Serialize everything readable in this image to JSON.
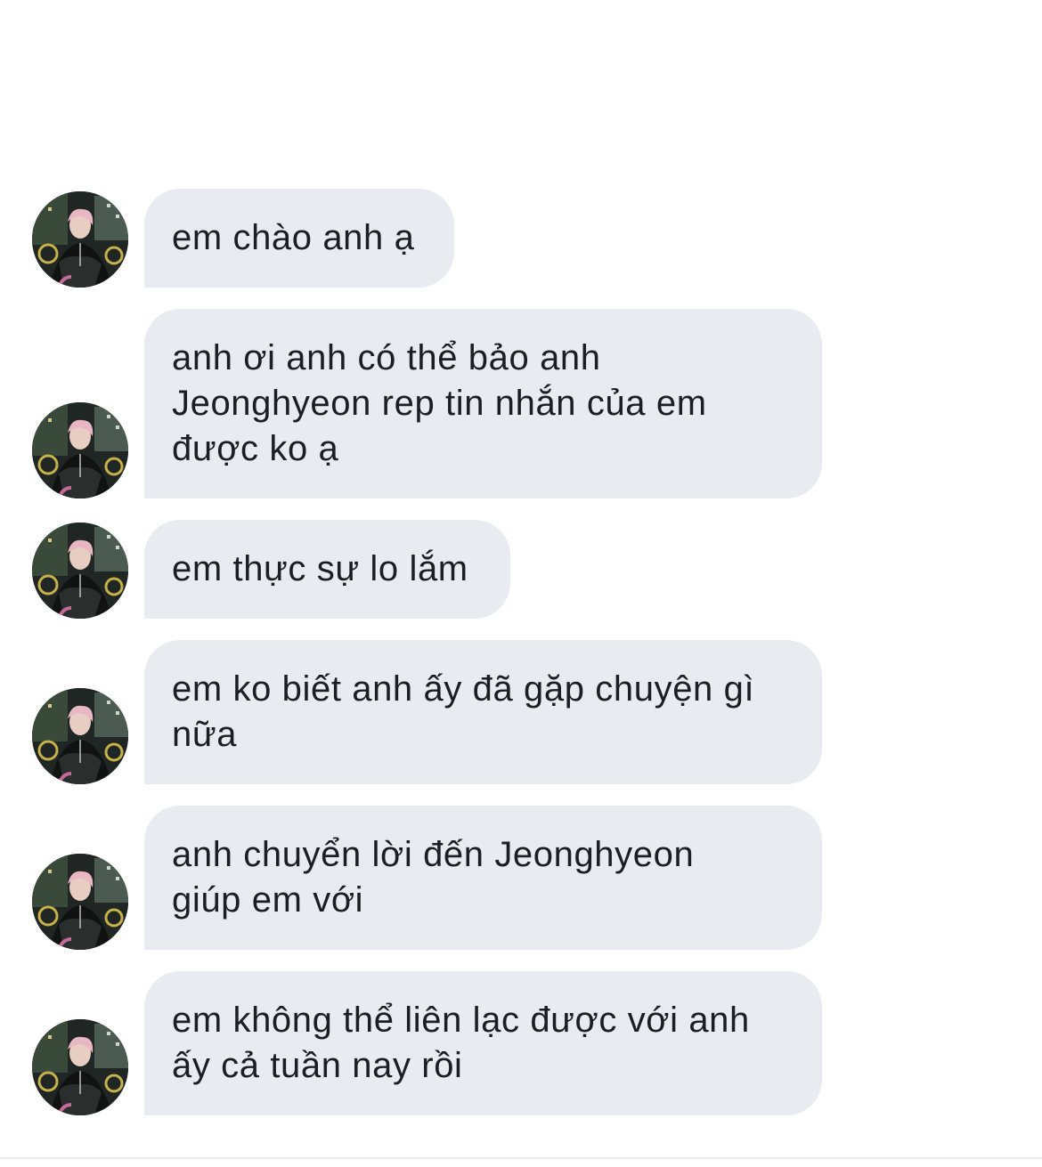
{
  "messages": [
    {
      "text": "em chào anh ạ"
    },
    {
      "text": "anh ơi anh có thể bảo anh\nJeonghyeon rep tin nhắn của em\nđược ko ạ"
    },
    {
      "text": "em thực sự lo lắm"
    },
    {
      "text": "em ko biết anh ấy đã gặp chuyện gì\nnữa"
    },
    {
      "text": "anh chuyển lời đến Jeonghyeon\ngiúp em với"
    },
    {
      "text": "em không thể liên lạc được với anh\nấy cả tuần nay rồi"
    }
  ],
  "colors": {
    "background": "#ffffff",
    "bubble": "#e8ecf1",
    "text": "#1c1e21"
  },
  "icons": {
    "avatar": "contact-photo"
  }
}
